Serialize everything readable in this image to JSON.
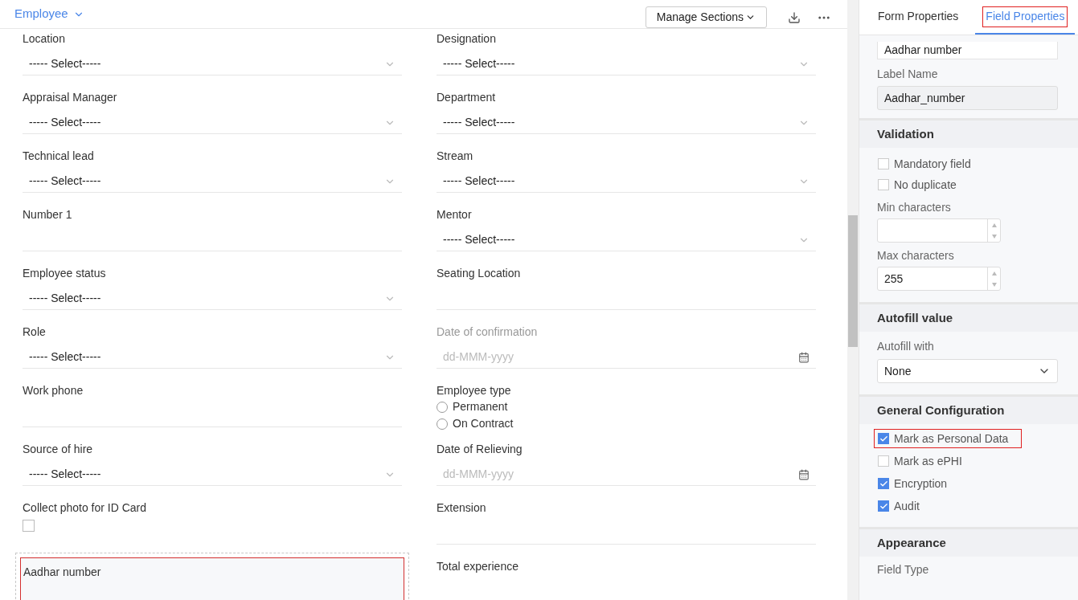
{
  "header": {
    "form_name": "Employee",
    "manage_button": "Manage Sections"
  },
  "form": {
    "columns": [
      [
        {
          "label": "Location",
          "kind": "select",
          "value": "----- Select-----"
        },
        {
          "label": "Appraisal Manager",
          "kind": "select",
          "value": "----- Select-----"
        },
        {
          "label": "Technical lead",
          "kind": "select",
          "value": "----- Select-----"
        },
        {
          "label": "Number 1",
          "kind": "text"
        },
        {
          "label": "Employee status",
          "kind": "select",
          "value": "----- Select-----"
        },
        {
          "label": "Role",
          "kind": "select",
          "value": "----- Select-----"
        },
        {
          "label": "Work phone",
          "kind": "text"
        },
        {
          "label": "Source of hire",
          "kind": "select",
          "value": "----- Select-----"
        },
        {
          "label": "Collect photo for ID Card",
          "kind": "checkbox",
          "checked": false
        },
        {
          "label": "Aadhar number",
          "kind": "text",
          "selected": true
        }
      ],
      [
        {
          "label": "Designation",
          "kind": "select",
          "value": "----- Select-----"
        },
        {
          "label": "Department",
          "kind": "select",
          "value": "----- Select-----"
        },
        {
          "label": "Stream",
          "kind": "select",
          "value": "----- Select-----"
        },
        {
          "label": "Mentor",
          "kind": "select",
          "value": "----- Select-----"
        },
        {
          "label": "Seating Location",
          "kind": "text"
        },
        {
          "label": "Date of confirmation",
          "kind": "date",
          "placeholder": "dd-MMM-yyyy",
          "disabled": true
        },
        {
          "label": "Employee type",
          "kind": "radio",
          "options": [
            {
              "label": "Permanent",
              "selected": false
            },
            {
              "label": "On Contract",
              "selected": false
            }
          ]
        },
        {
          "label": "Date of Relieving",
          "kind": "date",
          "placeholder": "dd-MMM-yyyy",
          "disabled": false
        },
        {
          "label": "Extension",
          "kind": "text"
        },
        {
          "label": "Total experience",
          "kind": "text"
        }
      ]
    ]
  },
  "properties": {
    "tabs": [
      {
        "label": "Form Properties",
        "selected": false,
        "highlighted": false
      },
      {
        "label": "Field Properties",
        "selected": true,
        "highlighted": true
      }
    ],
    "field_name": "Aadhar number",
    "label_name": {
      "label": "Label Name",
      "value": "Aadhar_number"
    },
    "sections": [
      {
        "title": "Validation",
        "items": [
          {
            "kind": "checkbox",
            "label": "Mandatory field",
            "checked": false,
            "highlighted": false
          },
          {
            "kind": "checkbox",
            "label": "No duplicate",
            "checked": false,
            "highlighted": false
          },
          {
            "kind": "number",
            "label": "Min characters"
          },
          {
            "kind": "number",
            "label": "Max characters",
            "value": "255"
          }
        ]
      },
      {
        "title": "Autofill value",
        "items": [
          {
            "kind": "select",
            "label": "Autofill with",
            "value": "None"
          }
        ]
      },
      {
        "title": "General Configuration",
        "items": [
          {
            "kind": "checkbox",
            "label": "Mark as Personal Data",
            "checked": true,
            "highlighted": true
          },
          {
            "kind": "checkbox",
            "label": "Mark as ePHI",
            "checked": false,
            "highlighted": false
          },
          {
            "kind": "checkbox",
            "label": "Encryption",
            "checked": true,
            "highlighted": false
          },
          {
            "kind": "checkbox",
            "label": "Audit",
            "checked": true,
            "highlighted": false
          }
        ]
      },
      {
        "title": "Appearance",
        "items": [
          {
            "kind": "caption",
            "label": "Field Type"
          }
        ]
      }
    ]
  }
}
